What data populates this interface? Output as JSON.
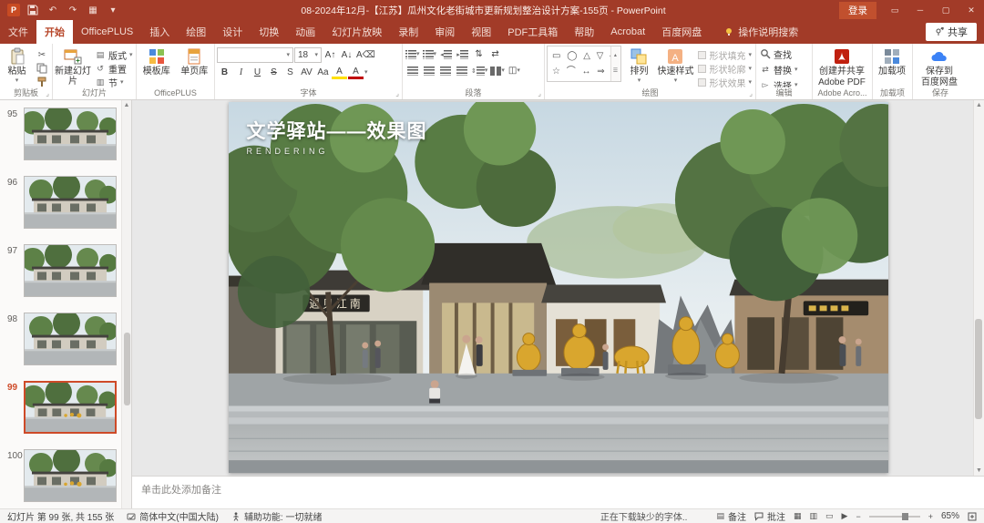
{
  "titlebar": {
    "title": "08-2024年12月-【江苏】瓜州文化老街城市更新规划整治设计方案-155页 - PowerPoint",
    "login_label": "登录"
  },
  "tabs": {
    "items": [
      {
        "id": "file",
        "label": "文件",
        "active": false
      },
      {
        "id": "home",
        "label": "开始",
        "active": true
      },
      {
        "id": "officeplus",
        "label": "OfficePLUS",
        "active": false
      },
      {
        "id": "insert",
        "label": "插入",
        "active": false
      },
      {
        "id": "draw",
        "label": "绘图",
        "active": false
      },
      {
        "id": "design",
        "label": "设计",
        "active": false
      },
      {
        "id": "transitions",
        "label": "切换",
        "active": false
      },
      {
        "id": "animations",
        "label": "动画",
        "active": false
      },
      {
        "id": "slideshow",
        "label": "幻灯片放映",
        "active": false
      },
      {
        "id": "record",
        "label": "录制",
        "active": false
      },
      {
        "id": "review",
        "label": "审阅",
        "active": false
      },
      {
        "id": "view",
        "label": "视图",
        "active": false
      },
      {
        "id": "pdftools",
        "label": "PDF工具箱",
        "active": false
      },
      {
        "id": "help",
        "label": "帮助",
        "active": false
      },
      {
        "id": "acrobat",
        "label": "Acrobat",
        "active": false
      },
      {
        "id": "baidu",
        "label": "百度网盘",
        "active": false
      }
    ],
    "tell_me": "操作说明搜索",
    "share_label": "共享"
  },
  "ribbon": {
    "clipboard": {
      "group_label": "剪贴板",
      "paste_label": "粘贴"
    },
    "slides": {
      "group_label": "幻灯片",
      "new_slide": "新建幻灯片",
      "layout": "版式",
      "reset": "重置",
      "section": "节"
    },
    "officeplus": {
      "group_label": "OfficePLUS",
      "template_lib": "模板库",
      "page_lib": "单页库"
    },
    "font": {
      "group_label": "字体",
      "font_name": "",
      "font_size": "18",
      "bold": "B",
      "italic": "I",
      "underline": "U",
      "strike": "S",
      "shadow": "S",
      "spacing": "AV",
      "case": "Aa",
      "highlight": "A",
      "color": "A"
    },
    "paragraph": {
      "group_label": "段落"
    },
    "drawing": {
      "group_label": "绘图",
      "shapes_row1": "▭ ◯ △ ▽ ◇",
      "shapes_row2": "☆ ⌒ ↔ ⇒ ▱",
      "arrange": "排列",
      "quick_styles": "快速样式",
      "shape_fill": "形状填充",
      "shape_outline": "形状轮廓",
      "shape_effects": "形状效果"
    },
    "editing": {
      "group_label": "编辑",
      "find": "查找",
      "replace": "替换",
      "select": "选择"
    },
    "adobe": {
      "group_label": "Adobe Acro...",
      "line1": "创建并共享",
      "line2": "Adobe PDF"
    },
    "addins": {
      "group_label": "加载项",
      "button": "加载项"
    },
    "baidu": {
      "group_label": "保存",
      "line1": "保存到",
      "line2": "百度网盘"
    }
  },
  "thumbnails": {
    "items": [
      {
        "number": "95",
        "selected": false
      },
      {
        "number": "96",
        "selected": false
      },
      {
        "number": "97",
        "selected": false
      },
      {
        "number": "98",
        "selected": false
      },
      {
        "number": "99",
        "selected": true
      },
      {
        "number": "100",
        "selected": false
      }
    ]
  },
  "slide": {
    "title": "文学驿站——效果图",
    "subtitle": "RENDERING",
    "sign_text": "遇见江南"
  },
  "notes": {
    "placeholder": "单击此处添加备注"
  },
  "statusbar": {
    "slide_info": "幻灯片 第 99 张, 共 155 张",
    "language": "简体中文(中国大陆)",
    "accessibility": "辅助功能: 一切就绪",
    "downloading": "正在下载缺少的字体..",
    "notes_btn": "备注",
    "comments_btn": "批注",
    "zoom_level": "65%"
  },
  "colors": {
    "accent": "#B7472A",
    "thumbnail_selection": "#CE4A28",
    "sculpture_gold": "#D9A62E"
  }
}
